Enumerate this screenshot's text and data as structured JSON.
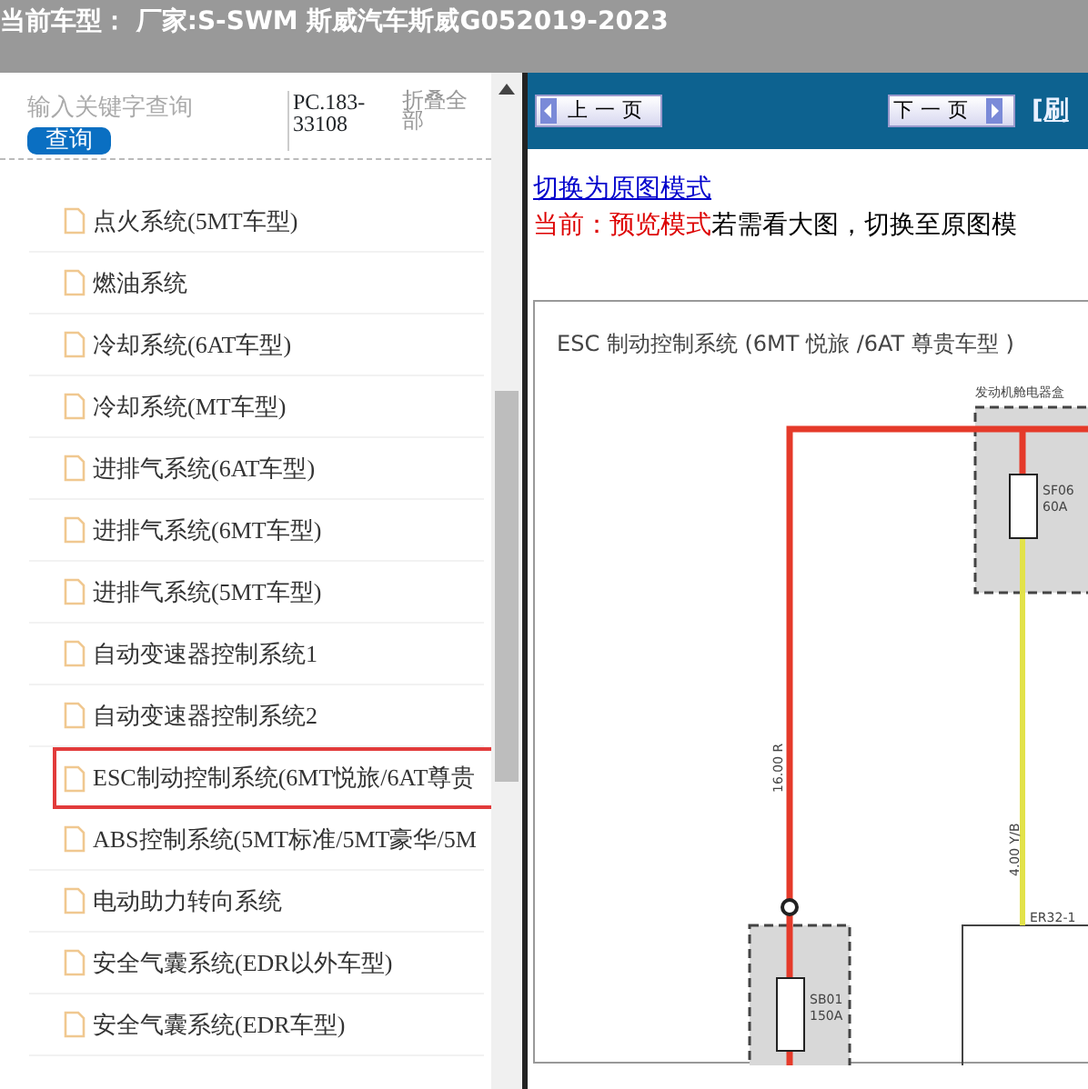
{
  "header": {
    "title": "当前车型：  厂家:S-SWM 斯威汽车斯威G052019-2023"
  },
  "sidebar": {
    "search": {
      "placeholder": "输入关键字查询",
      "button": "查询"
    },
    "code": "PC.183-33108",
    "collapse_all": "折叠全部",
    "items": [
      {
        "label": "点火系统(5MT车型)",
        "selected": false
      },
      {
        "label": "燃油系统",
        "selected": false
      },
      {
        "label": "冷却系统(6AT车型)",
        "selected": false
      },
      {
        "label": "冷却系统(MT车型)",
        "selected": false
      },
      {
        "label": "进排气系统(6AT车型)",
        "selected": false
      },
      {
        "label": "进排气系统(6MT车型)",
        "selected": false
      },
      {
        "label": "进排气系统(5MT车型)",
        "selected": false
      },
      {
        "label": "自动变速器控制系统1",
        "selected": false
      },
      {
        "label": "自动变速器控制系统2",
        "selected": false
      },
      {
        "label": "ESC制动控制系统(6MT悦旅/6AT尊贵",
        "selected": true
      },
      {
        "label": "ABS控制系统(5MT标准/5MT豪华/5M",
        "selected": false
      },
      {
        "label": "电动助力转向系统",
        "selected": false
      },
      {
        "label": "安全气囊系统(EDR以外车型)",
        "selected": false
      },
      {
        "label": "安全气囊系统(EDR车型)",
        "selected": false
      }
    ]
  },
  "toolbar": {
    "prev": "上一页",
    "next": "下一页",
    "refresh": "[刷"
  },
  "viewer": {
    "switch_link": "切换为原图模式",
    "mode_label": "当前：预览模式",
    "hint": "若需看大图，切换至原图模",
    "diagram": {
      "title": "ESC 制动控制系统 (6MT 悦旅 /6AT 尊贵车型 )",
      "box_label": "发动机舱电器盒",
      "fuse_1": "SF06",
      "fuse_1_rating": "60A",
      "wire_1": "16.00 R",
      "wire_2": "4.00 Y/B",
      "fuse_2": "SB01",
      "fuse_2_rating": "150A",
      "connector": "ER32-1"
    }
  }
}
